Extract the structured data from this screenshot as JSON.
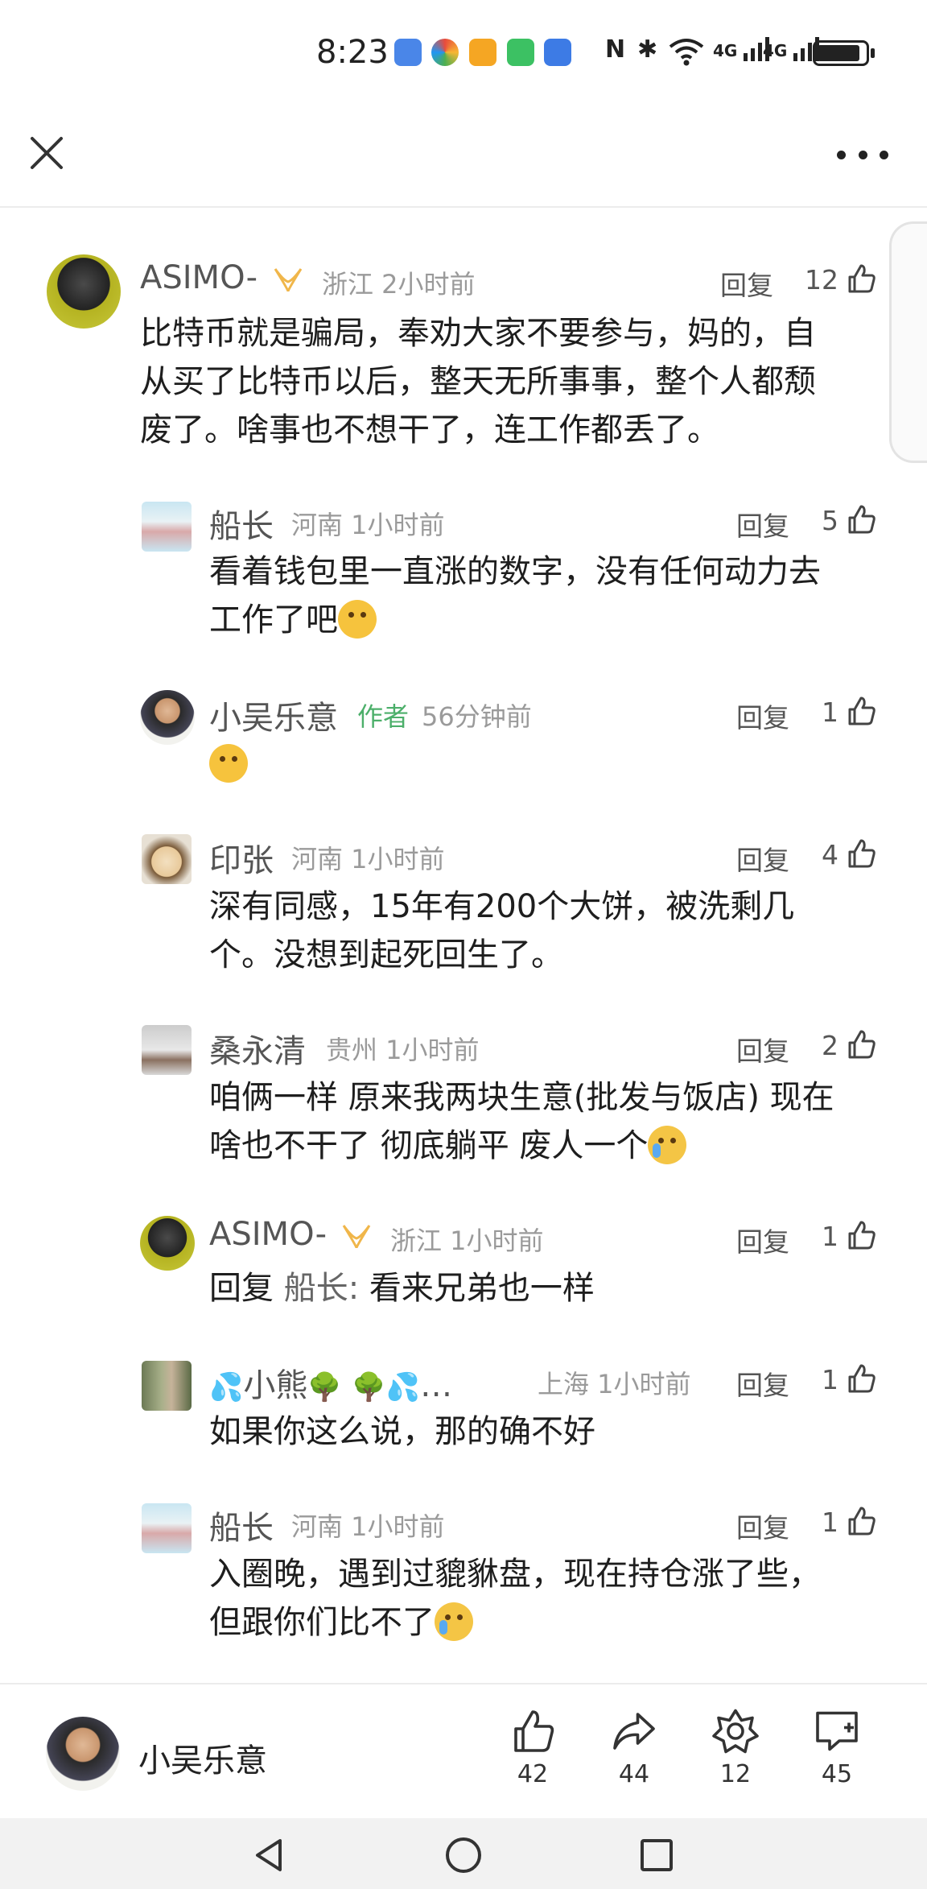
{
  "status_bar": {
    "time": "8:23",
    "sys_glyphs": [
      "N",
      "✱",
      "4G",
      "4G"
    ]
  },
  "comments": [
    {
      "name": "ASIMO-",
      "location": "浙江 2小时前",
      "reply": "回复",
      "likes": "12",
      "text": [
        "比特币就是骗局，奉劝大家不要参与，妈的，自",
        "从买了比特币以后，整天无所事事，整个人都颓",
        "废了。啥事也不想干了，连工作都丢了。"
      ]
    },
    {
      "name": "船长",
      "location": "河南 1小时前",
      "reply": "回复",
      "likes": "5",
      "text": [
        "看着钱包里一直涨的数字，没有任何动力去",
        "工作了吧"
      ]
    },
    {
      "name": "小吴乐意",
      "author_tag": "作者",
      "location": "56分钟前",
      "reply": "回复",
      "likes": "1"
    },
    {
      "name": "印张",
      "location": "河南 1小时前",
      "reply": "回复",
      "likes": "4",
      "text": [
        "深有同感，15年有200个大饼，被洗剩几",
        "个。没想到起死回生了。"
      ]
    },
    {
      "name": "桑永清",
      "location": "贵州 1小时前",
      "reply": "回复",
      "likes": "2",
      "text": [
        "咱俩一样 原来我两块生意(批发与饭店) 现在",
        "啥也不干了 彻底躺平 废人一个"
      ]
    },
    {
      "name": "ASIMO-",
      "location": "浙江 1小时前",
      "reply": "回复",
      "likes": "1",
      "text_prefix": "回复",
      "text_mention": "船长:",
      "text_rest": "看来兄弟也一样"
    },
    {
      "name": "小熊",
      "name_suffix": "…",
      "location": "上海 1小时前",
      "reply": "回复",
      "likes": "1",
      "text": [
        "如果你这么说，那的确不好"
      ]
    },
    {
      "name": "船长",
      "location": "河南 1小时前",
      "reply": "回复",
      "likes": "1",
      "text": [
        "入圈晚，遇到过貔貅盘，现在持仓涨了些，",
        "但跟你们比不了"
      ]
    }
  ],
  "bottom_bar": {
    "author_name": "小吴乐意",
    "like_count": "42",
    "share_count": "44",
    "star_count": "12",
    "comment_count": "45"
  }
}
